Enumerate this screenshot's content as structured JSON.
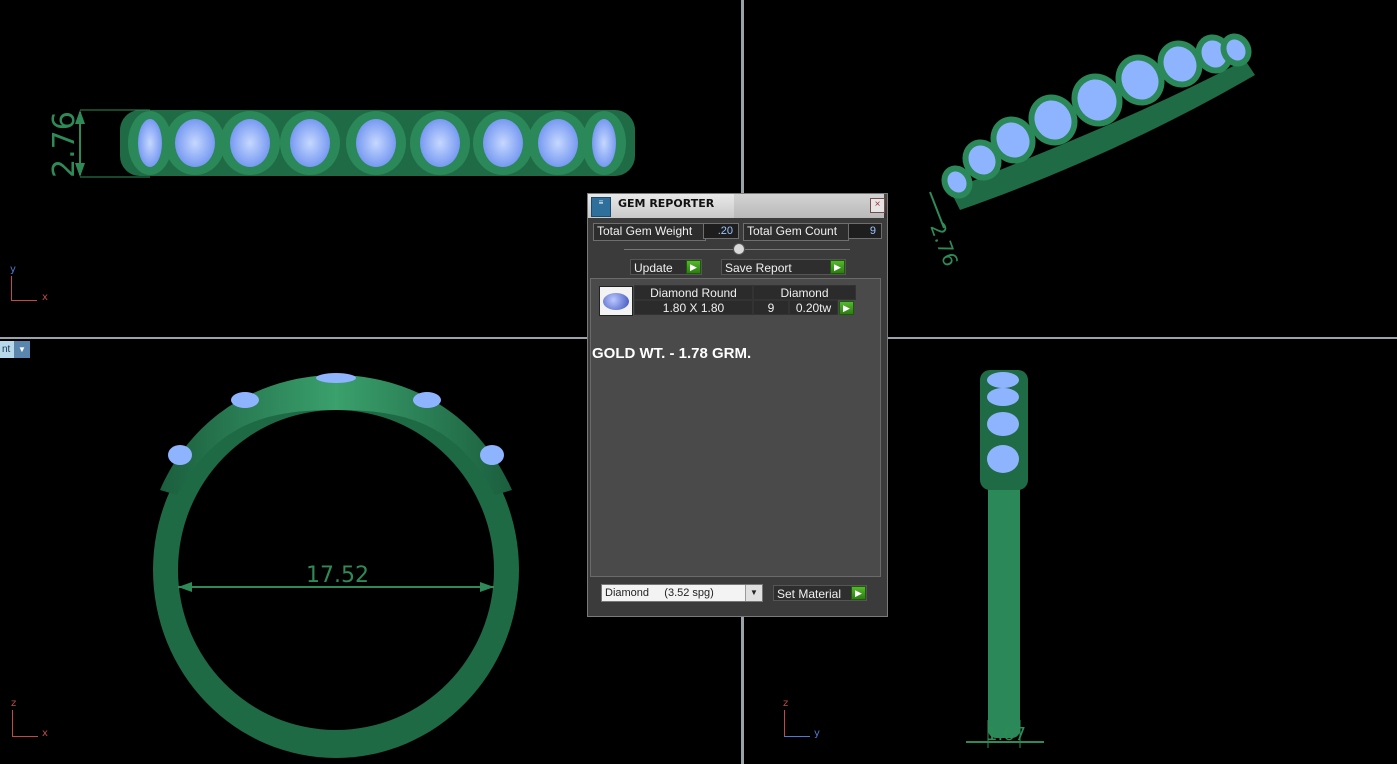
{
  "viewports": {
    "top": {
      "axis_v": "y",
      "axis_h": "x",
      "dimension": "2.76"
    },
    "perspective": {
      "dimension": "2.76"
    },
    "front": {
      "axis_v": "z",
      "axis_h": "x",
      "dimension": "17.52",
      "dropdown_label": "nt"
    },
    "side": {
      "axis_v": "z",
      "axis_h": "y",
      "dimension": "1.67"
    }
  },
  "dialog": {
    "title": "GEM REPORTER",
    "close_glyph": "×",
    "icon_text": "≡",
    "total_gem_weight_label": "Total Gem Weight",
    "total_gem_weight_value": ".20",
    "total_gem_count_label": "Total Gem Count",
    "total_gem_count_value": "9",
    "update_label": "Update",
    "save_report_label": "Save Report",
    "go_glyph": "▶",
    "gems_table": {
      "headers": [
        "Diamond Round",
        "Diamond"
      ],
      "rows": [
        {
          "size": "1.80 X 1.80",
          "count": "9",
          "weight": "0.20tw"
        }
      ]
    },
    "gold_weight_text": "GOLD WT. - 1.78 GRM.",
    "material_select": "Diamond     (3.52 spg)",
    "set_material_label": "Set Material"
  },
  "colors": {
    "metal": "#2e8b57",
    "gem": "#8fb4ff",
    "background": "#000000"
  }
}
